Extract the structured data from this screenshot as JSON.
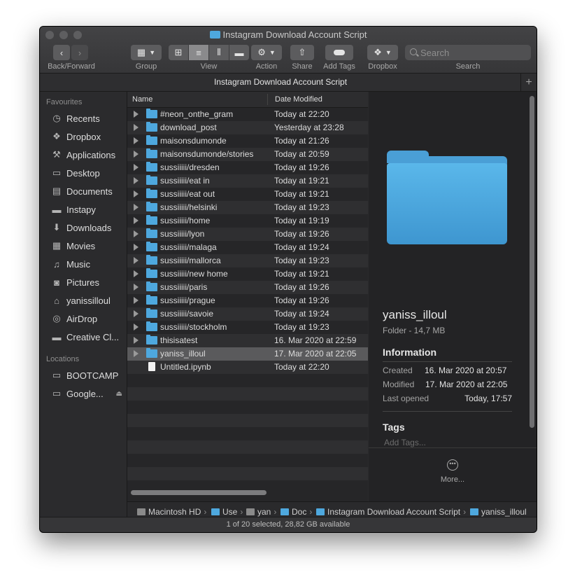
{
  "window": {
    "title": "Instagram Download Account Script"
  },
  "toolbar": {
    "back_forward_label": "Back/Forward",
    "group_label": "Group",
    "view_label": "View",
    "action_label": "Action",
    "share_label": "Share",
    "add_tags_label": "Add Tags",
    "dropbox_label": "Dropbox",
    "search_label": "Search",
    "search_placeholder": "Search"
  },
  "tab": {
    "title": "Instagram Download Account Script"
  },
  "sidebar": {
    "favourites_header": "Favourites",
    "favourites": [
      {
        "label": "Recents",
        "icon": "clock-icon"
      },
      {
        "label": "Dropbox",
        "icon": "dropbox-icon"
      },
      {
        "label": "Applications",
        "icon": "applications-icon"
      },
      {
        "label": "Desktop",
        "icon": "desktop-icon"
      },
      {
        "label": "Documents",
        "icon": "document-icon"
      },
      {
        "label": "Instapy",
        "icon": "folder-icon"
      },
      {
        "label": "Downloads",
        "icon": "download-icon"
      },
      {
        "label": "Movies",
        "icon": "film-icon"
      },
      {
        "label": "Music",
        "icon": "music-note-icon"
      },
      {
        "label": "Pictures",
        "icon": "camera-icon"
      },
      {
        "label": "yanissilloul",
        "icon": "home-icon"
      },
      {
        "label": "AirDrop",
        "icon": "airdrop-icon"
      },
      {
        "label": "Creative Cl...",
        "icon": "folder-icon"
      }
    ],
    "locations_header": "Locations",
    "locations": [
      {
        "label": "BOOTCAMP",
        "icon": "disk-icon"
      },
      {
        "label": "Google...",
        "icon": "disk-icon"
      }
    ]
  },
  "columns": {
    "name": "Name",
    "date": "Date Modified"
  },
  "files": [
    {
      "name": "#neon_onthe_gram",
      "date": "Today at 22:20",
      "type": "folder"
    },
    {
      "name": "download_post",
      "date": "Yesterday at 23:28",
      "type": "folder"
    },
    {
      "name": "maisonsdumonde",
      "date": "Today at 21:26",
      "type": "folder"
    },
    {
      "name": "maisonsdumonde/stories",
      "date": "Today at 20:59",
      "type": "folder"
    },
    {
      "name": "sussiiiii/dresden",
      "date": "Today at 19:26",
      "type": "folder"
    },
    {
      "name": "sussiiiii/eat in",
      "date": "Today at 19:21",
      "type": "folder"
    },
    {
      "name": "sussiiiii/eat out",
      "date": "Today at 19:21",
      "type": "folder"
    },
    {
      "name": "sussiiiii/helsinki",
      "date": "Today at 19:23",
      "type": "folder"
    },
    {
      "name": "sussiiiii/home",
      "date": "Today at 19:19",
      "type": "folder"
    },
    {
      "name": "sussiiiii/lyon",
      "date": "Today at 19:26",
      "type": "folder"
    },
    {
      "name": "sussiiiii/malaga",
      "date": "Today at 19:24",
      "type": "folder"
    },
    {
      "name": "sussiiiii/mallorca",
      "date": "Today at 19:23",
      "type": "folder"
    },
    {
      "name": "sussiiiii/new home",
      "date": "Today at 19:21",
      "type": "folder"
    },
    {
      "name": "sussiiiii/paris",
      "date": "Today at 19:26",
      "type": "folder"
    },
    {
      "name": "sussiiiii/prague",
      "date": "Today at 19:26",
      "type": "folder"
    },
    {
      "name": "sussiiiii/savoie",
      "date": "Today at 19:24",
      "type": "folder"
    },
    {
      "name": "sussiiiii/stockholm",
      "date": "Today at 19:23",
      "type": "folder"
    },
    {
      "name": "thisisatest",
      "date": "16. Mar 2020 at 22:59",
      "type": "folder"
    },
    {
      "name": "yaniss_illoul",
      "date": "17. Mar 2020 at 22:05",
      "type": "folder",
      "selected": true
    },
    {
      "name": "Untitled.ipynb",
      "date": "Today at 22:20",
      "type": "file"
    }
  ],
  "preview": {
    "name": "yaniss_illoul",
    "kind": "Folder - 14,7 MB",
    "information_header": "Information",
    "created_label": "Created",
    "created_value": "16. Mar 2020 at 20:57",
    "modified_label": "Modified",
    "modified_value": "17. Mar 2020 at 22:05",
    "last_opened_label": "Last opened",
    "last_opened_value": "Today, 17:57",
    "tags_header": "Tags",
    "tags_placeholder": "Add Tags...",
    "more_label": "More..."
  },
  "pathbar": {
    "items": [
      "Macintosh HD",
      "Use",
      "yan",
      "Doc",
      "Instagram Download Account Script",
      "yaniss_illoul"
    ]
  },
  "status": {
    "text": "1 of 20 selected, 28,82 GB available"
  },
  "colors": {
    "folder": "#4ea8de",
    "window_bg": "#2a2a2c",
    "selection": "#5a5a5c"
  }
}
